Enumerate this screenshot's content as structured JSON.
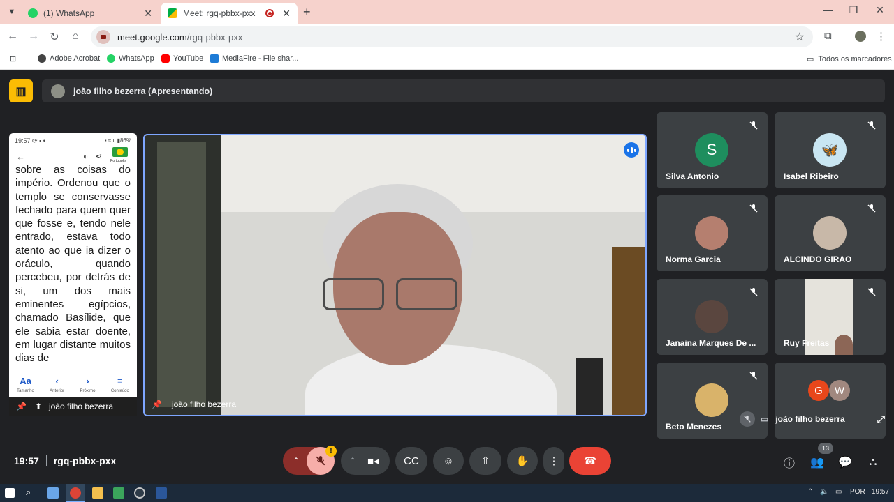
{
  "browser": {
    "tabs": [
      {
        "title": "(1) WhatsApp",
        "active": false
      },
      {
        "title": "Meet: rgq-pbbx-pxx",
        "active": true
      }
    ],
    "url_domain": "meet.google.com",
    "url_path": "/rgq-pbbx-pxx",
    "bookmarks": [
      "Adobe Acrobat",
      "WhatsApp",
      "YouTube",
      "MediaFire - File shar..."
    ],
    "all_bookmarks": "Todos os marcadores"
  },
  "meet": {
    "presenter_bar": "joão filho bezerra (Apresentando)",
    "phone": {
      "time": "19:57",
      "battery": "86%",
      "language": "Português",
      "text": "sobre as coisas do império. Ordenou que o templo se conservasse fechado para quem quer que fosse e, tendo nele entrado, estava todo atento ao que ia dizer o oráculo, quando percebeu, por detrás de si, um dos mais eminentes egípcios, chamado Basílide, que ele sabia estar doente, em lugar distante muitos dias de",
      "nav": [
        {
          "glyph": "Aa",
          "label": "Tamanho"
        },
        {
          "glyph": "‹",
          "label": "Anterior"
        },
        {
          "glyph": "›",
          "label": "Próximo"
        },
        {
          "glyph": "≡",
          "label": "Conteúdo"
        }
      ]
    },
    "phone_label": "joão filho bezerra",
    "main_label": "joão filho bezerra",
    "participants": [
      {
        "name": "Silva Antonio",
        "initial": "S",
        "color": "#1e8e5e"
      },
      {
        "name": "Isabel Ribeiro",
        "initial": "",
        "color": "#c9e6f2"
      },
      {
        "name": "Norma Garcia",
        "initial": "",
        "color": "#b57f6f"
      },
      {
        "name": "ALCINDO GIRAO",
        "initial": "",
        "color": "#c8b8a8"
      },
      {
        "name": "Janaina Marques De ...",
        "initial": "",
        "color": "#5a463f"
      },
      {
        "name": "Ruy Freitas",
        "initial": "",
        "color": "#e5e3dc"
      },
      {
        "name": "Beto Menezes",
        "initial": "",
        "color": "#d9b36a"
      }
    ],
    "others": {
      "g": "G",
      "w": "W"
    },
    "self_name": "joão filho bezerra",
    "clock": "19:57",
    "meeting_code": "rgq-pbbx-pxx",
    "people_count": "13"
  },
  "taskbar": {
    "lang": "POR",
    "time": "19:57"
  }
}
